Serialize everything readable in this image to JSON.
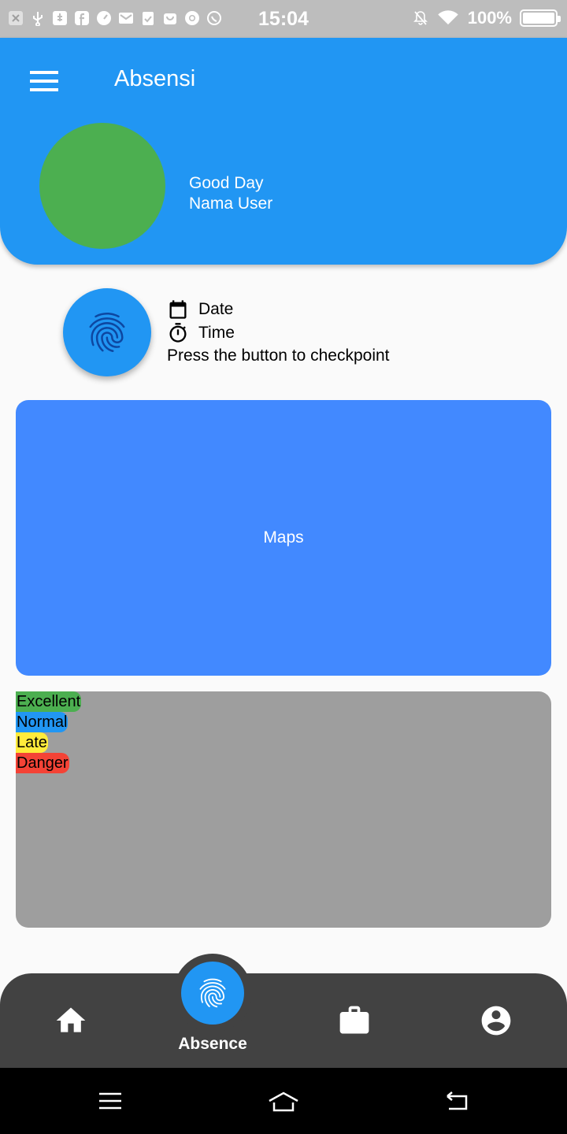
{
  "status_bar": {
    "time": "15:04",
    "battery": "100%",
    "notification_icons": [
      "close-box-icon",
      "usb-icon",
      "usb-debug-icon",
      "facebook-icon",
      "gauge-icon",
      "mail-icon",
      "clipboard-check-icon",
      "shop-bag-icon",
      "chrome-icon",
      "whatsapp-icon"
    ]
  },
  "app_bar": {
    "title": "Absensi"
  },
  "profile": {
    "greeting": "Good Day",
    "name": "Nama User"
  },
  "checkpoint": {
    "date_label": "Date",
    "time_label": "Time",
    "instruction": "Press the button to checkpoint"
  },
  "maps": {
    "label": "Maps"
  },
  "legend": {
    "items": [
      {
        "label": "Excellent",
        "color": "#4caf50"
      },
      {
        "label": "Normal",
        "color": "#2196f3"
      },
      {
        "label": "Late",
        "color": "#ffeb3b"
      },
      {
        "label": "Danger",
        "color": "#f44336"
      }
    ]
  },
  "bottom_nav": {
    "active_label": "Absence",
    "items": [
      "home-icon",
      "fingerprint-icon",
      "briefcase-icon",
      "account-circle-icon"
    ]
  },
  "colors": {
    "primary": "#2196f3",
    "avatar": "#4caf50",
    "maps_bg": "#4289ff",
    "legend_bg": "#9e9e9e",
    "nav_bg": "#424242"
  }
}
